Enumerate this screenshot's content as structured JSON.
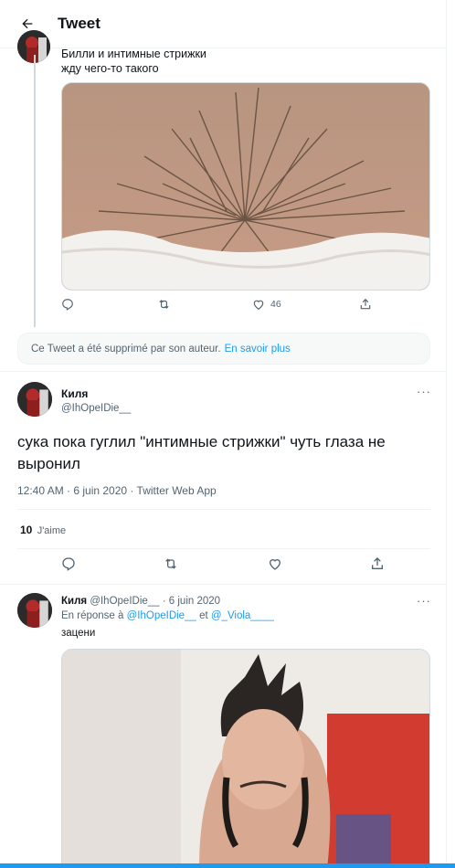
{
  "header": {
    "title": "Tweet"
  },
  "quoted_tweet": {
    "text_line1": "Билли и интимные стрижки",
    "text_line2": "жду чего-то такого",
    "actions": {
      "like_count": "46"
    }
  },
  "deleted_notice": {
    "text": "Ce Tweet a été supprimé par son auteur.",
    "link": "En savoir plus"
  },
  "main_tweet": {
    "name": "Киля",
    "handle": "@IhOpeIDie__",
    "more": "···",
    "text": "сука пока гуглил \"интимные стрижки\" чуть глаза не выронил",
    "meta": "12:40 AM · 6 juin 2020 · Twitter Web App",
    "likes_count": "10",
    "likes_label": "J'aime"
  },
  "reply_tweet": {
    "name": "Киля",
    "handle_date": "@IhOpeIDie__ · 6 juin 2020",
    "reply_prefix": "En réponse à",
    "mention1": "@IhOpeIDie__",
    "reply_and": "et",
    "mention2": "@_Viola____",
    "text": "зацени",
    "more": "···"
  },
  "colors": {
    "accent": "#1d9bf0",
    "secondary_text": "#536471",
    "border": "#eff3f4"
  },
  "icons": [
    "back-arrow-icon",
    "reply-icon",
    "retweet-icon",
    "like-icon",
    "share-icon",
    "more-icon"
  ]
}
